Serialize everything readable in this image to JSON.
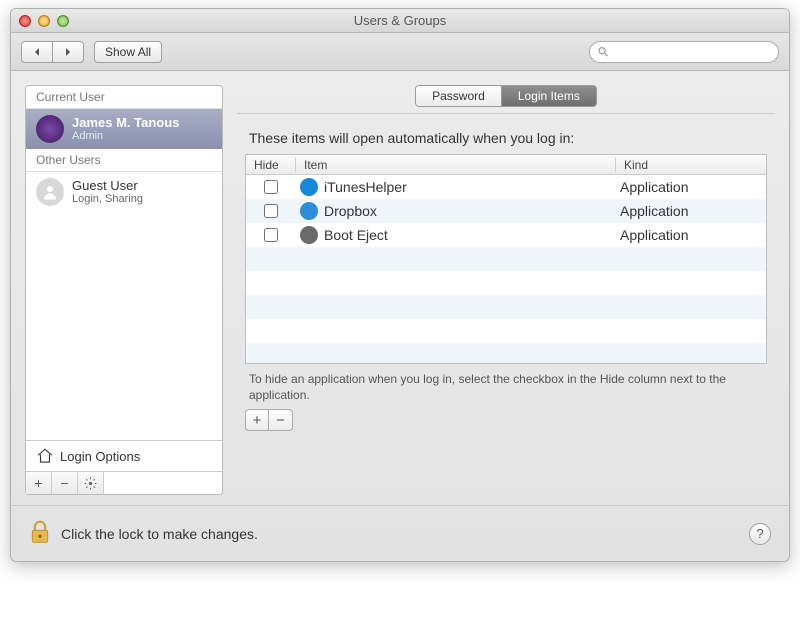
{
  "window": {
    "title": "Users & Groups"
  },
  "toolbar": {
    "showAll": "Show All",
    "searchPlaceholder": ""
  },
  "sidebar": {
    "currentUserHeader": "Current User",
    "otherUsersHeader": "Other Users",
    "currentUser": {
      "name": "James M. Tanous",
      "role": "Admin"
    },
    "otherUsers": [
      {
        "name": "Guest User",
        "role": "Login, Sharing"
      }
    ],
    "loginOptions": "Login Options"
  },
  "tabs": {
    "password": "Password",
    "loginItems": "Login Items"
  },
  "panel": {
    "intro": "These items will open automatically when you log in:",
    "columns": {
      "hide": "Hide",
      "item": "Item",
      "kind": "Kind"
    },
    "items": [
      {
        "name": "iTunesHelper",
        "kind": "Application",
        "hide": false,
        "iconColor": "#1787d6"
      },
      {
        "name": "Dropbox",
        "kind": "Application",
        "hide": false,
        "iconColor": "#2d8ed8"
      },
      {
        "name": "Boot Eject",
        "kind": "Application",
        "hide": false,
        "iconColor": "#6b6b6b"
      }
    ],
    "hint": "To hide an application when you log in, select the checkbox in the Hide column next to the application."
  },
  "footer": {
    "lockMessage": "Click the lock to make changes."
  }
}
